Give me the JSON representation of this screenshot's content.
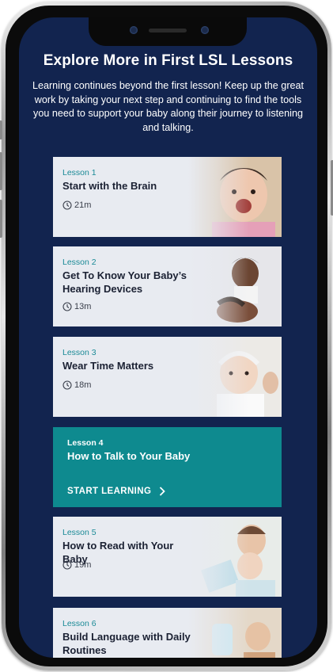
{
  "page": {
    "heading": "Explore More in First LSL Lessons",
    "intro": "Learning continues beyond the first lesson! Keep up the great work by taking your next step and continuing to find the tools you need to support your baby along their journey to listening and talking."
  },
  "lessons": [
    {
      "number": "Lesson 1",
      "title": "Start with the Brain",
      "duration": "21m",
      "icon": "clock-icon"
    },
    {
      "number": "Lesson 2",
      "title": "Get To Know Your Baby’s Hearing Devices",
      "duration": "13m",
      "icon": "clock-icon"
    },
    {
      "number": "Lesson 3",
      "title": "Wear Time Matters",
      "duration": "18m",
      "icon": "clock-icon"
    },
    {
      "number": "Lesson 4",
      "title": "How to Talk to Your Baby",
      "cta": "START LEARNING",
      "icon": "chevron-right-icon"
    },
    {
      "number": "Lesson 5",
      "title": "How to Read with Your Baby",
      "duration": "19m",
      "icon": "clock-icon"
    },
    {
      "number": "Lesson 6",
      "title": "Build Language with Daily Routines"
    }
  ],
  "colors": {
    "background": "#12244f",
    "card": "#e8ebf1",
    "active_card": "#0e8a8f",
    "lesson_number": "#1a8a96"
  }
}
